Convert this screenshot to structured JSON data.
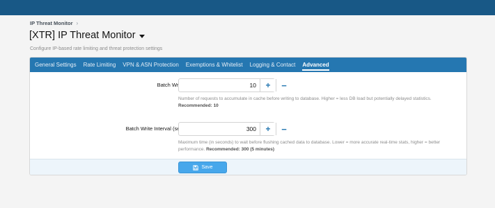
{
  "breadcrumb": {
    "item": "IP Threat Monitor",
    "separator": "›"
  },
  "page": {
    "title": "[XTR] IP Threat Monitor",
    "description": "Configure IP-based rate limiting and threat protection settings"
  },
  "tabs": [
    {
      "label": "General Settings"
    },
    {
      "label": "Rate Limiting"
    },
    {
      "label": "VPN & ASN Protection"
    },
    {
      "label": "Exemptions & Whitelist"
    },
    {
      "label": "Logging & Contact"
    },
    {
      "label": "Advanced",
      "active": true
    }
  ],
  "fields": {
    "batch_size": {
      "label": "Batch Write Size:",
      "value": "10",
      "plus": "+",
      "minus": "−",
      "hint": "Number of requests to accumulate in cache before writing to database. Higher = less DB load but potentially delayed statistics.",
      "recommended": "Recommended: 10"
    },
    "batch_interval": {
      "label": "Batch Write Interval (seconds):",
      "value": "300",
      "plus": "+",
      "minus": "−",
      "hint": "Maximum time (in seconds) to wait before flushing cached data to database. Lower = more accurate real-time stats, higher = better performance.",
      "recommended": "Recommended: 300 (5 minutes)"
    }
  },
  "footer": {
    "save_label": "Save"
  },
  "colors": {
    "topbar": "#185886",
    "tabbar": "#2577b1",
    "save_button": "#47a7eb",
    "footer_bg": "#edf5fb"
  }
}
